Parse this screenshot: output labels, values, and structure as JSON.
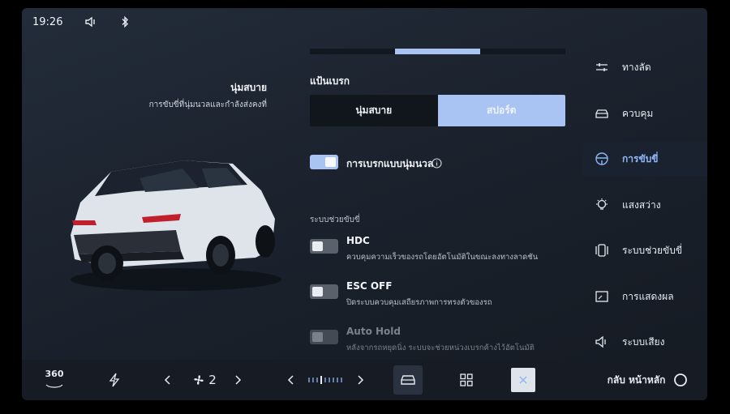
{
  "status": {
    "time": "19:26"
  },
  "left": {
    "title": "นุ่มสบาย",
    "subtitle": "การขับขี่ที่นุ่มนวลและกำลังส่งคงที่"
  },
  "brake": {
    "label": "แป้นเบรก",
    "modes": [
      "นุ่มสบาย",
      "สปอร์ต"
    ],
    "selected_mode": "สปอร์ต"
  },
  "soft_brake": {
    "label": "การเบรกแบบนุ่มนวล",
    "enabled": true
  },
  "assist": {
    "section_label": "ระบบช่วยขับขี่",
    "options": [
      {
        "title": "HDC",
        "desc": "ควบคุมความเร็วของรถโดยอัตโนมัติในขณะลงทางลาดชัน",
        "enabled": false
      },
      {
        "title": "ESC OFF",
        "desc": "ปิดระบบควบคุมเสถียรภาพการทรงตัวของรถ",
        "enabled": false
      },
      {
        "title": "Auto Hold",
        "desc": "หลังจากรถหยุดนิ่ง ระบบจะช่วยหน่วงเบรกค้างไว้อัตโนมัติ",
        "enabled": false
      }
    ]
  },
  "menu": {
    "items": [
      {
        "label": "ทางลัด",
        "icon": "sliders-icon"
      },
      {
        "label": "ควบคุม",
        "icon": "car-icon"
      },
      {
        "label": "การขับขี่",
        "icon": "steering-wheel-icon"
      },
      {
        "label": "แสงสว่าง",
        "icon": "bulb-icon"
      },
      {
        "label": "ระบบช่วยขับขี่",
        "icon": "assist-icon"
      },
      {
        "label": "การแสดงผล",
        "icon": "display-icon"
      },
      {
        "label": "ระบบเสียง",
        "icon": "speaker-icon"
      }
    ],
    "active_index": 2
  },
  "bottom": {
    "camera_label": "360",
    "fan_value": "2",
    "home_label": "กลับ หน้าหลัก"
  },
  "colors": {
    "accent": "#a9c4f2",
    "menu_active": "#8fb6f6"
  }
}
